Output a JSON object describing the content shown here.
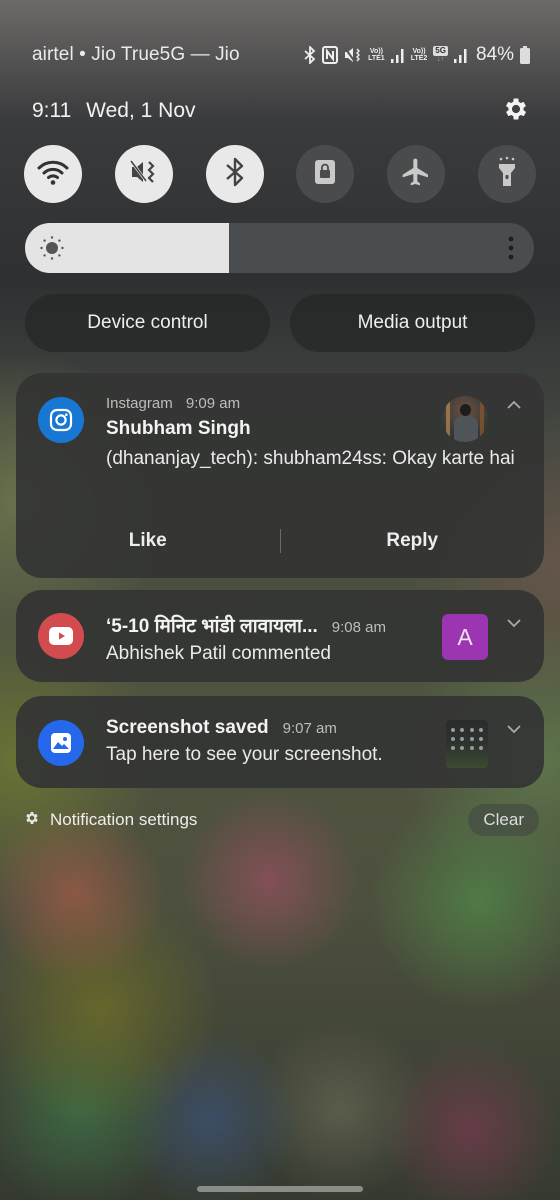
{
  "status_bar": {
    "carrier": "airtel • Jio True5G — Jio",
    "icons": [
      "bluetooth-icon",
      "nfc-icon",
      "vibrate-mute-icon",
      "volte-lte1-icon",
      "signal-1-icon",
      "volte-lte2-icon",
      "5g-icon",
      "signal-2-icon",
      "battery-icon"
    ],
    "volte1": {
      "top": "Vo))",
      "bottom": "LTE1"
    },
    "volte2": {
      "top": "Vo))",
      "bottom": "LTE2"
    },
    "network_badge": "5G",
    "battery_percent": "84%"
  },
  "header": {
    "time": "9:11",
    "date": "Wed, 1 Nov",
    "settings_icon": "gear-icon"
  },
  "quick_toggles": [
    {
      "name": "wifi",
      "icon": "wifi-icon",
      "state": "on"
    },
    {
      "name": "sound",
      "icon": "mute-vibrate-icon",
      "state": "on"
    },
    {
      "name": "bluetooth",
      "icon": "bluetooth-icon",
      "state": "on"
    },
    {
      "name": "rotation-lock",
      "icon": "portrait-lock-icon",
      "state": "off"
    },
    {
      "name": "airplane-mode",
      "icon": "airplane-icon",
      "state": "off"
    },
    {
      "name": "torch",
      "icon": "flashlight-icon",
      "state": "off"
    }
  ],
  "brightness": {
    "level_percent": 40,
    "icon": "sun-icon",
    "more_icon": "more-vertical-icon"
  },
  "pills": {
    "device_control": "Device control",
    "media_output": "Media output"
  },
  "notifications": [
    {
      "app": "Instagram",
      "icon": "instagram-icon",
      "color": "#1877d2",
      "time": "9:09 am",
      "title": "Shubham Singh",
      "text": "(dhananjay_tech): shubham24ss: Okay karte hai",
      "expanded": true,
      "actions": [
        "Like",
        "Reply"
      ]
    },
    {
      "app": "YouTube",
      "icon": "youtube-icon",
      "color": "#d24b4f",
      "title": "‘5-10 मिनिट भांडी लावायला...",
      "time": "9:08 am",
      "text": "Abhishek Patil commented",
      "avatar_letter": "A",
      "avatar_color": "#9b35b2",
      "expanded": false
    },
    {
      "app": "Screenshot",
      "icon": "gallery-icon",
      "color": "#2568ec",
      "title": "Screenshot saved",
      "time": "9:07 am",
      "text": "Tap here to see your screenshot.",
      "expanded": false
    }
  ],
  "footer": {
    "settings_label": "Notification settings",
    "clear_label": "Clear"
  }
}
